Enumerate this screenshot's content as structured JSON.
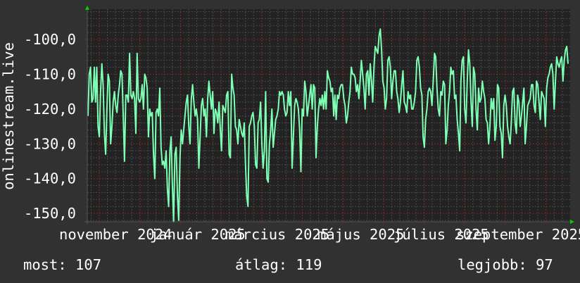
{
  "chart_data": {
    "type": "line",
    "ylabel": "onlinestream.live",
    "ylim": [
      -152.4,
      -91.3
    ],
    "yticks": [
      -100,
      -110,
      -120,
      -130,
      -140,
      -150
    ],
    "ytick_labels": [
      "-100,0",
      "-110,0",
      "-120,0",
      "-130,0",
      "-140,0",
      "-150,0"
    ],
    "xtick_labels": [
      "november 2024",
      "január 2025",
      "március 2025",
      "május 2025",
      "július 2025",
      "szeptember 2025"
    ],
    "grid": true,
    "colors": {
      "line": "#7dffb4",
      "plot_bg": "#222222",
      "major_grid": "#7a2a2a",
      "minor_grid": "#4a4a4a",
      "arrow": "#00d000"
    },
    "series": [
      {
        "name": "onlinestream.live",
        "values": [
          -122,
          -110,
          -108,
          -118,
          -117,
          -108,
          -118,
          -108,
          -125,
          -128,
          -115,
          -107,
          -113,
          -127,
          -133,
          -120,
          -110,
          -112,
          -130,
          -125,
          -118,
          -115,
          -119,
          -121,
          -116,
          -113,
          -109,
          -110,
          -122,
          -135,
          -116,
          -116,
          -118,
          -104,
          -116,
          -117,
          -115,
          -117,
          -127,
          -104,
          -117,
          -118,
          -117,
          -113,
          -120,
          -110,
          -111,
          -114,
          -128,
          -120,
          -122,
          -121,
          -133,
          -140,
          -121,
          -120,
          -122,
          -114,
          -131,
          -136,
          -135,
          -137,
          -132,
          -143,
          -148,
          -132,
          -128,
          -142,
          -155,
          -133,
          -131,
          -145,
          -152,
          -134,
          -126,
          -130,
          -126,
          -122,
          -118,
          -116,
          -125,
          -130,
          -117,
          -113,
          -118,
          -122,
          -120,
          -123,
          -137,
          -128,
          -119,
          -117,
          -122,
          -120,
          -128,
          -117,
          -112,
          -116,
          -120,
          -115,
          -127,
          -120,
          -121,
          -124,
          -118,
          -126,
          -132,
          -119,
          -120,
          -121,
          -116,
          -115,
          -133,
          -134,
          -110,
          -114,
          -116,
          -125,
          -126,
          -130,
          -123,
          -125,
          -127,
          -128,
          -124,
          -136,
          -145,
          -148,
          -125,
          -124,
          -122,
          -121,
          -125,
          -136,
          -137,
          -124,
          -123,
          -118,
          -130,
          -137,
          -132,
          -115,
          -140,
          -141,
          -130,
          -126,
          -120,
          -131,
          -127,
          -123,
          -122,
          -120,
          -115,
          -116,
          -115,
          -116,
          -120,
          -122,
          -121,
          -115,
          -119,
          -115,
          -137,
          -128,
          -119,
          -117,
          -118,
          -120,
          -126,
          -138,
          -120,
          -122,
          -112,
          -115,
          -122,
          -119,
          -116,
          -113,
          -120,
          -113,
          -114,
          -134,
          -125,
          -120,
          -117,
          -119,
          -116,
          -120,
          -115,
          -120,
          -109,
          -111,
          -112,
          -115,
          -114,
          -122,
          -116,
          -123,
          -116,
          -117,
          -114,
          -113,
          -113,
          -117,
          -119,
          -124,
          -122,
          -118,
          -115,
          -108,
          -110,
          -110,
          -111,
          -115,
          -113,
          -117,
          -112,
          -106,
          -110,
          -114,
          -120,
          -110,
          -109,
          -116,
          -107,
          -112,
          -118,
          -108,
          -102,
          -103,
          -104,
          -99,
          -97,
          -103,
          -112,
          -114,
          -120,
          -117,
          -106,
          -105,
          -108,
          -117,
          -112,
          -109,
          -109,
          -115,
          -117,
          -121,
          -118,
          -113,
          -109,
          -118,
          -119,
          -121,
          -115,
          -117,
          -116,
          -120,
          -120,
          -118,
          -115,
          -106,
          -105,
          -108,
          -114,
          -116,
          -128,
          -131,
          -123,
          -120,
          -115,
          -114,
          -115,
          -119,
          -112,
          -104,
          -105,
          -114,
          -120,
          -122,
          -115,
          -116,
          -112,
          -113,
          -130,
          -126,
          -119,
          -115,
          -108,
          -110,
          -109,
          -117,
          -116,
          -123,
          -127,
          -132,
          -112,
          -106,
          -105,
          -120,
          -124,
          -112,
          -103,
          -107,
          -118,
          -125,
          -108,
          -110,
          -120,
          -126,
          -114,
          -118,
          -117,
          -112,
          -115,
          -117,
          -123,
          -124,
          -130,
          -125,
          -117,
          -120,
          -117,
          -129,
          -125,
          -113,
          -114,
          -125,
          -127,
          -134,
          -119,
          -116,
          -119,
          -125,
          -128,
          -130,
          -124,
          -115,
          -114,
          -124,
          -127,
          -116,
          -118,
          -125,
          -122,
          -118,
          -114,
          -130,
          -125,
          -119,
          -118,
          -117,
          -113,
          -113,
          -119,
          -121,
          -112,
          -113,
          -118,
          -123,
          -115,
          -116,
          -117,
          -125,
          -114,
          -111,
          -110,
          -108,
          -107,
          -110,
          -120,
          -112,
          -105,
          -107,
          -108,
          -106,
          -105,
          -112,
          -106,
          -103,
          -102,
          -107
        ]
      }
    ],
    "legend": {
      "current": "most: 107",
      "average": "átlag: 119",
      "best": "legjobb: 97"
    }
  }
}
